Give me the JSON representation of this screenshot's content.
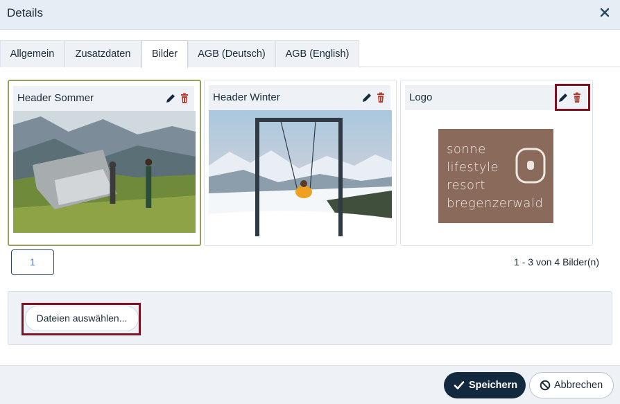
{
  "dialog": {
    "title": "Details"
  },
  "tabs": [
    {
      "label": "Allgemein",
      "active": false
    },
    {
      "label": "Zusatzdaten",
      "active": false
    },
    {
      "label": "Bilder",
      "active": true
    },
    {
      "label": "AGB (Deutsch)",
      "active": false
    },
    {
      "label": "AGB (English)",
      "active": false
    }
  ],
  "images": [
    {
      "title": "Header Sommer",
      "selected": true,
      "highlighted": false
    },
    {
      "title": "Header Winter",
      "selected": false,
      "highlighted": false
    },
    {
      "title": "Logo",
      "selected": false,
      "highlighted": true,
      "logo_lines": [
        "sonne",
        "lifestyle",
        "resort",
        "bregenzerwald"
      ]
    }
  ],
  "pager": {
    "current_page": "1",
    "info": "1 - 3 von 4 Bilder(n)"
  },
  "upload": {
    "button_label": "Dateien auswählen..."
  },
  "footer": {
    "save_label": "Speichern",
    "cancel_label": "Abbrechen"
  },
  "icons": {
    "edit": "pencil-icon",
    "delete": "trash-icon",
    "close": "close-icon",
    "save": "checkmark-icon",
    "cancel": "ban-icon"
  },
  "colors": {
    "header_bg": "#e7edf5",
    "primary_dark": "#13293d",
    "delete_red": "#c0392b",
    "highlight": "#7c1221",
    "selected_border": "#98a15c",
    "logo_bg": "#8a6a5a"
  }
}
